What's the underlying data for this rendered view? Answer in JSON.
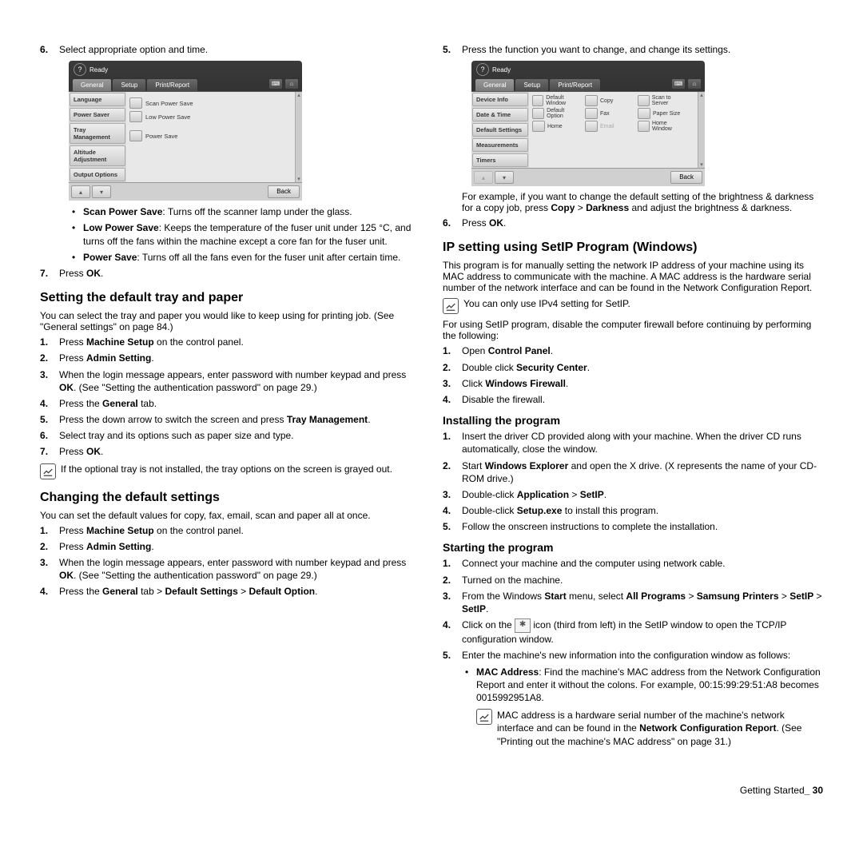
{
  "left": {
    "step6": "Select appropriate option and time.",
    "ss1": {
      "ready": "Ready",
      "tabs": [
        "General",
        "Setup",
        "Print/Report"
      ],
      "side": [
        "Language",
        "Power Saver",
        "Tray Management",
        "Altitude Adjustment",
        "Output Options"
      ],
      "items": [
        "Scan Power Save",
        "Low Power Save",
        "Power Save"
      ],
      "back": "Back"
    },
    "bl1a": "Scan Power Save",
    "bl1b": ": Turns off the scanner lamp under the glass.",
    "bl2a": "Low Power Save",
    "bl2b": ": Keeps the temperature of the fuser unit under 125 °C, and turns off the fans within the machine except a core fan for the fuser unit.",
    "bl3a": "Power Save",
    "bl3b": ": Turns off all the fans even for the fuser unit after certain time.",
    "step7a": "Press ",
    "step7b": "OK",
    "h2a": "Setting the default tray and paper",
    "p2a": "You can select the tray and paper you would like to keep using for printing job. (See \"General settings\" on page 84.)",
    "ol2": {
      "i1a": "Press ",
      "i1b": "Machine Setup",
      "i1c": " on the control panel.",
      "i2a": "Press ",
      "i2b": "Admin Setting",
      "i2c": ".",
      "i3a": "When the login message appears, enter password with number keypad and press ",
      "i3b": "OK",
      "i3c": ". (See \"Setting the authentication password\" on page 29.)",
      "i4a": "Press the ",
      "i4b": "General",
      "i4c": " tab.",
      "i5a": "Press the down arrow to switch the screen and press ",
      "i5b": "Tray Management",
      "i5c": ".",
      "i6": "Select tray and its options such as paper size and type.",
      "i7a": "Press ",
      "i7b": "OK",
      "i7c": "."
    },
    "note1": "If the optional tray is not installed, the tray options on the screen is grayed out.",
    "h2b": "Changing the default settings",
    "p2b": "You can set the default values for copy, fax, email, scan and paper all at once.",
    "ol3": {
      "i1a": "Press ",
      "i1b": "Machine Setup",
      "i1c": " on the control panel.",
      "i2a": "Press ",
      "i2b": "Admin Setting",
      "i2c": ".",
      "i3a": "When the login message appears, enter password with number keypad and press ",
      "i3b": "OK",
      "i3c": ". (See \"Setting the authentication password\" on page 29.)",
      "i4a": "Press the ",
      "i4b": "General",
      "i4c": " tab > ",
      "i4d": "Default Settings",
      "i4e": " > ",
      "i4f": "Default Option",
      "i4g": "."
    }
  },
  "right": {
    "step5": "Press the function you want to change, and change its settings.",
    "ss2": {
      "ready": "Ready",
      "tabs": [
        "General",
        "Setup",
        "Print/Report"
      ],
      "side": [
        "Device Info",
        "Date & Time",
        "Default Settings",
        "Measurements",
        "Timers"
      ],
      "grid": [
        {
          "l": "Default Window"
        },
        {
          "l": "Copy"
        },
        {
          "l": "Scan to Server"
        },
        {
          "l": "Default Option"
        },
        {
          "l": "Fax"
        },
        {
          "l": "Paper Size"
        },
        {
          "l": "Home"
        },
        {
          "l": "Email",
          "dim": true
        },
        {
          "l": "Home Window"
        }
      ],
      "back": "Back"
    },
    "pex": "For example, if you want to change the default setting of the brightness & darkness for a copy job, press ",
    "pexb": "Copy",
    "pexc": " > ",
    "pexd": "Darkness",
    "pexe": " and adjust the brightness & darkness.",
    "step6a": "Press ",
    "step6b": "OK",
    "step6c": ".",
    "h2a": "IP setting using SetIP Program (Windows)",
    "p1": "This program is for manually setting the network IP address of your machine using its MAC address to communicate with the machine. A MAC address is the hardware serial number of the network interface and can be found in the Network Configuration Report.",
    "note1": "You can only use IPv4 setting for SetIP.",
    "p2": "For using SetIP program, disable the computer firewall before continuing by performing the following:",
    "ol1": {
      "i1a": "Open ",
      "i1b": "Control Panel",
      "i1c": ".",
      "i2a": "Double click ",
      "i2b": "Security Center",
      "i2c": ".",
      "i3a": "Click ",
      "i3b": "Windows Firewall",
      "i3c": ".",
      "i4": "Disable the firewall."
    },
    "h3a": "Installing the program",
    "ol2": {
      "i1": "Insert the driver CD provided along with your machine. When the driver CD runs automatically, close the window.",
      "i2a": "Start ",
      "i2b": "Windows Explorer",
      "i2c": " and open the X drive. (X represents the name of your CD-ROM drive.)",
      "i3a": "Double-click ",
      "i3b": "Application",
      "i3c": " > ",
      "i3d": "SetIP",
      "i3e": ".",
      "i4a": "Double-click ",
      "i4b": "Setup.exe",
      "i4c": " to install this program.",
      "i5": "Follow the onscreen instructions to complete the installation."
    },
    "h3b": "Starting the program",
    "ol3": {
      "i1": "Connect your machine and the computer using network cable.",
      "i2": "Turned on the machine.",
      "i3a": "From the Windows ",
      "i3b": "Start",
      "i3c": " menu, select ",
      "i3d": "All Programs",
      "i3e": " > ",
      "i3f": "Samsung Printers",
      "i3g": " > ",
      "i3h": "SetIP",
      "i3i": " > ",
      "i3j": "SetIP",
      "i3k": ".",
      "i4a": "Click on the ",
      "i4b": " icon (third from left) in the SetIP window to open the TCP/IP configuration window.",
      "i5": "Enter the machine's new information into the configuration window as follows:",
      "b1a": "MAC Address",
      "b1b": ": Find the machine's MAC address from the Network Configuration Report and enter it without the colons. For example, 00:15:99:29:51:A8 becomes 0015992951A8.",
      "note2a": "MAC address is a hardware serial number of the machine's network interface and can be found in the ",
      "note2b": "Network Configuration Report",
      "note2c": ". (See \"Printing out the machine's MAC address\" on page 31.)"
    }
  },
  "footer": {
    "label": "Getting Started",
    "page": "_ 30"
  }
}
